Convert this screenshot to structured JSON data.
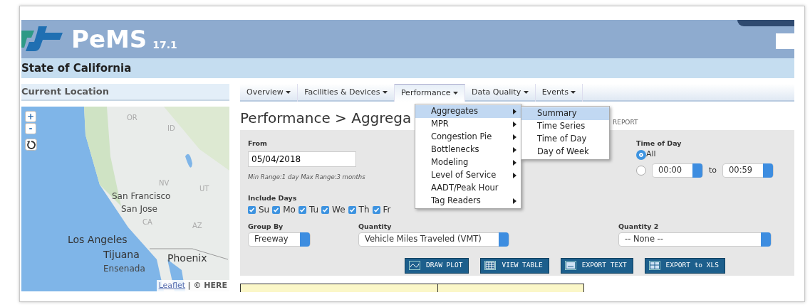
{
  "header": {
    "app_name": "PeMS",
    "version": "17.1",
    "subtitle": "State of California"
  },
  "sidebar": {
    "title": "Current Location",
    "map": {
      "zoom_in": "+",
      "zoom_out": "-",
      "labels": [
        {
          "text": "OR",
          "kind": "region"
        },
        {
          "text": "ID",
          "kind": "region"
        },
        {
          "text": "NV",
          "kind": "region"
        },
        {
          "text": "UT",
          "kind": "region"
        },
        {
          "text": "San Francisco",
          "kind": "city"
        },
        {
          "text": "San Jose",
          "kind": "city"
        },
        {
          "text": "CA",
          "kind": "region"
        },
        {
          "text": "AZ",
          "kind": "region"
        },
        {
          "text": "Los Angeles",
          "kind": "bigcity"
        },
        {
          "text": "Tijuana",
          "kind": "bigcity"
        },
        {
          "text": "Phoenix",
          "kind": "bigcity"
        },
        {
          "text": "Ensenada",
          "kind": "city"
        }
      ],
      "attribution_link": "Leaflet",
      "attribution_text": "| © HERE"
    }
  },
  "nav": [
    {
      "label": "Overview",
      "selected": false
    },
    {
      "label": "Facilities & Devices",
      "selected": false
    },
    {
      "label": "Performance",
      "selected": true
    },
    {
      "label": "Data Quality",
      "selected": false
    },
    {
      "label": "Events",
      "selected": false
    }
  ],
  "page_title": "Performance > Aggrega",
  "report_link": "REPORT",
  "menu": [
    {
      "label": "Aggregates",
      "has_submenu": true,
      "selected": true
    },
    {
      "label": "MPR",
      "has_submenu": true,
      "selected": false
    },
    {
      "label": "Congestion Pie",
      "has_submenu": true,
      "selected": false
    },
    {
      "label": "Bottlenecks",
      "has_submenu": true,
      "selected": false
    },
    {
      "label": "Modeling",
      "has_submenu": true,
      "selected": false
    },
    {
      "label": "Level of Service",
      "has_submenu": true,
      "selected": false
    },
    {
      "label": "AADT/Peak Hour",
      "has_submenu": false,
      "selected": false
    },
    {
      "label": "Tag Readers",
      "has_submenu": true,
      "selected": false
    }
  ],
  "submenu": [
    {
      "label": "Summary",
      "selected": true
    },
    {
      "label": "Time Series",
      "selected": false
    },
    {
      "label": "Time of Day",
      "selected": false
    },
    {
      "label": "Day of Week",
      "selected": false
    }
  ],
  "form": {
    "from_label": "From",
    "from_value": "05/04/2018",
    "range_hint": "Min Range:1 day Max Range:3 months",
    "days_label": "Include Days",
    "days": [
      {
        "label": "Su",
        "checked": true
      },
      {
        "label": "Mo",
        "checked": true
      },
      {
        "label": "Tu",
        "checked": true
      },
      {
        "label": "We",
        "checked": true
      },
      {
        "label": "Th",
        "checked": true
      },
      {
        "label": "Fr",
        "checked": true
      }
    ],
    "time_label": "Time of Day",
    "time_all": {
      "label": "All",
      "selected": true
    },
    "time_range": {
      "selected": false,
      "start": "00:00",
      "to": "to",
      "end": "00:59"
    },
    "group_by_label": "Group By",
    "group_by": "Freeway",
    "quantity_label": "Quantity",
    "quantity": "Vehicle Miles Traveled (VMT)",
    "quantity2_label": "Quantity 2",
    "quantity2": "-- None --"
  },
  "actions": [
    {
      "label": "DRAW PLOT",
      "kind": "plot"
    },
    {
      "label": "VIEW TABLE",
      "kind": "table"
    },
    {
      "label": "EXPORT TEXT",
      "kind": "text"
    },
    {
      "label": "EXPORT to XLS",
      "kind": "xls"
    }
  ]
}
